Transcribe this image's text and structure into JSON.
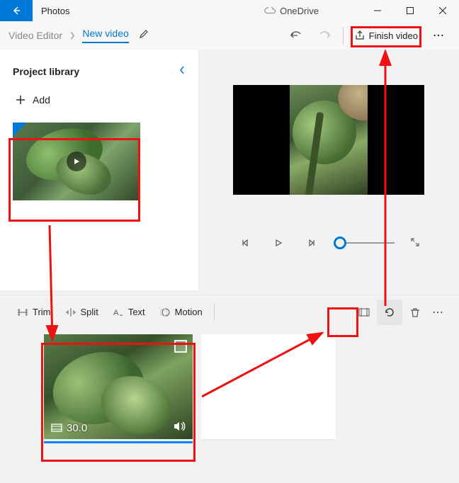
{
  "titlebar": {
    "app_name": "Photos",
    "onedrive_label": "OneDrive"
  },
  "cmdbar": {
    "breadcrumb_parent": "Video Editor",
    "breadcrumb_current": "New video",
    "finish_label": "Finish video"
  },
  "library": {
    "title": "Project library",
    "add_label": "Add"
  },
  "toolbar": {
    "trim": "Trim",
    "split": "Split",
    "text": "Text",
    "motion": "Motion"
  },
  "clip": {
    "duration": "30.0"
  }
}
